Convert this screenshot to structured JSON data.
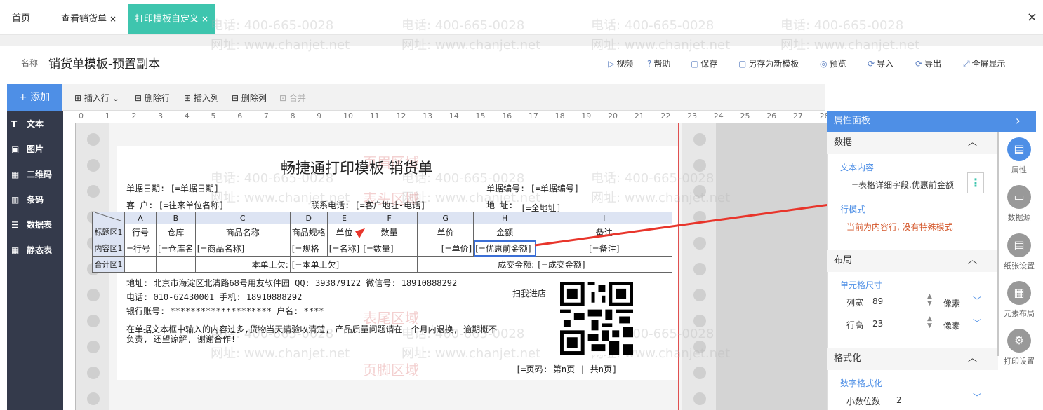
{
  "tabs": [
    {
      "label": "首页"
    },
    {
      "label": "查看销货单",
      "close": "×"
    },
    {
      "label": "打印模板自定义",
      "close": "×"
    }
  ],
  "window_close": "×",
  "header": {
    "name_label": "名称",
    "name_value": "销货单模板-预置副本"
  },
  "top_tools": [
    {
      "icon": "play-icon",
      "label": "视频"
    },
    {
      "icon": "help-icon",
      "label": "帮助"
    },
    {
      "icon": "save-icon",
      "label": "保存"
    },
    {
      "icon": "save-as-icon",
      "label": "另存为新模板"
    },
    {
      "icon": "preview-icon",
      "label": "预览"
    },
    {
      "icon": "import-icon",
      "label": "导入"
    },
    {
      "icon": "export-icon",
      "label": "导出"
    },
    {
      "icon": "fullscreen-icon",
      "label": "全屏显示"
    }
  ],
  "toolbar": {
    "add": "+ 添加",
    "insert_row": "插入行",
    "delete_row": "删除行",
    "insert_col": "插入列",
    "delete_col": "删除列",
    "merge": "合并"
  },
  "left_menu": [
    {
      "label": "文本",
      "glyph": "T"
    },
    {
      "label": "图片",
      "glyph": "▣"
    },
    {
      "label": "二维码",
      "glyph": "▦"
    },
    {
      "label": "条码",
      "glyph": "▥"
    },
    {
      "label": "数据表",
      "glyph": "☰"
    },
    {
      "label": "静态表",
      "glyph": "▦"
    }
  ],
  "ruler_ticks": [
    "0",
    "1",
    "2",
    "3",
    "4",
    "5",
    "6",
    "7",
    "8",
    "9",
    "10",
    "11",
    "12",
    "13",
    "14",
    "15",
    "16",
    "17",
    "18",
    "19",
    "20",
    "21",
    "22",
    "23",
    "24",
    "25",
    "26",
    "27",
    "28"
  ],
  "watermark": {
    "phone": "电话: 400-665-0028",
    "site": "网址: www.chanjet.net"
  },
  "zones": {
    "header": "页眉区域",
    "table_head": "表头区域",
    "table_tail": "表尾区域",
    "footer": "页脚区域"
  },
  "doc": {
    "title": "畅捷通打印模板 销货单",
    "date_line": "单据日期: [=单据日期]",
    "number_line": "单据编号: [=单据编号]",
    "customer_line": "客    户: [=往来单位名称]",
    "contact_line": "联系电话: [=客户地址-电话]",
    "address_line": "地  址:",
    "address_val": "[=全地址]",
    "columns": [
      "",
      "A",
      "B",
      "C",
      "D",
      "E",
      "F",
      "G",
      "H",
      "I"
    ],
    "header_row": [
      "标题区1",
      "行号",
      "仓库",
      "商品名称",
      "商品规格",
      "单位",
      "数量",
      "单价",
      "金额",
      "备注"
    ],
    "content_row": [
      "内容区1",
      "=行号",
      "[=仓库名",
      "[=商品名称]",
      "[=规格",
      "[=名称]",
      "[=数量]",
      "[=单价]",
      "[=优惠前金额]",
      "[=备注]"
    ],
    "total_row": [
      "合计区1",
      "本单上欠:",
      "[=本单上欠]",
      "成交金额:",
      "[=成交金额]"
    ],
    "company_addr": "地址: 北京市海淀区北清路68号用友软件园   QQ: 393879122   微信号: 18910888292",
    "phone": "电话: 010-62430001          手机: 18910888292",
    "bank": "银行账号: ********************   户名: ****",
    "notice1": "在单据文本框中输入的内容过多,货物当天请验收清楚, 产品质量问题请在一个月内退换, 逾期概不",
    "notice2": "负责, 还望谅解, 谢谢合作!",
    "scan": "扫我进店",
    "page_footer": "[=页码: 第n页 | 共n页]"
  },
  "props": {
    "title": "属性面板",
    "collapse": "›",
    "sections": {
      "data": "数据",
      "layout": "布局",
      "format": "格式化"
    },
    "text_content_label": "文本内容",
    "text_content_value": "=表格详细字段.优惠前金额",
    "more": "⋮",
    "row_mode_label": "行模式",
    "row_mode_value": "当前为内容行, 没有特殊模式",
    "cell_size_label": "单元格尺寸",
    "col_width_label": "列宽",
    "col_width_value": "89",
    "row_height_label": "行高",
    "row_height_value": "23",
    "unit": "像素",
    "number_format_label": "数字格式化",
    "decimals_label": "小数位数",
    "decimals_value": "2"
  },
  "right_menu": [
    {
      "label": "属性",
      "icon": "property-icon"
    },
    {
      "label": "数据源",
      "icon": "datasource-icon"
    },
    {
      "label": "纸张设置",
      "icon": "paper-icon"
    },
    {
      "label": "元素布局",
      "icon": "layout-icon"
    },
    {
      "label": "打印设置",
      "icon": "print-settings-icon"
    }
  ],
  "colors": {
    "accent": "#4e8fe6",
    "teal": "#3ec5ae",
    "sidebar": "#343a4b",
    "arrow": "#e8352b"
  }
}
